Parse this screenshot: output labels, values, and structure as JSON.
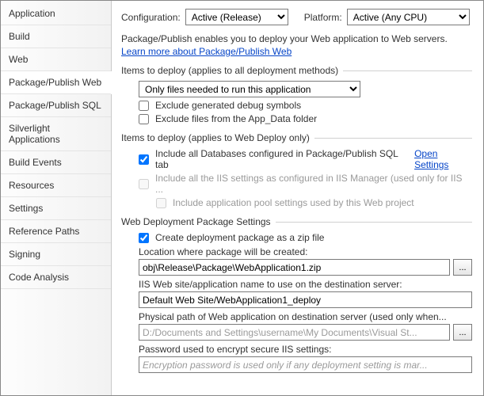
{
  "sidebar": {
    "items": [
      "Application",
      "Build",
      "Web",
      "Package/Publish Web",
      "Package/Publish SQL",
      "Silverlight Applications",
      "Build Events",
      "Resources",
      "Settings",
      "Reference Paths",
      "Signing",
      "Code Analysis"
    ],
    "active_index": 3
  },
  "top": {
    "config_label": "Configuration:",
    "config_value": "Active (Release)",
    "platform_label": "Platform:",
    "platform_value": "Active (Any CPU)"
  },
  "intro": {
    "line1": "Package/Publish enables you to deploy your Web application to Web servers.",
    "link": "Learn more about Package/Publish Web"
  },
  "section_all": {
    "header": "Items to deploy (applies to all deployment methods)",
    "select_value": "Only files needed to run this application",
    "cb_exclude_debug": "Exclude generated debug symbols",
    "cb_exclude_appdata": "Exclude files from the App_Data folder"
  },
  "section_webdeploy": {
    "header": "Items to deploy (applies to Web Deploy only)",
    "cb_include_db": "Include all Databases configured in Package/Publish SQL tab",
    "open_settings": "Open Settings",
    "cb_include_iis": "Include all the IIS settings as configured in IIS Manager (used only for IIS ...",
    "cb_include_apppool": "Include application pool settings used by this Web project"
  },
  "section_pkg": {
    "header": "Web Deployment Package Settings",
    "cb_zip": "Create deployment package as a zip file",
    "loc_caption": "Location where package will be created:",
    "loc_value": "obj\\Release\\Package\\WebApplication1.zip",
    "browse": "...",
    "iis_caption": "IIS Web site/application name to use on the destination server:",
    "iis_value": "Default Web Site/WebApplication1_deploy",
    "phys_caption": "Physical path of Web application on destination server (used only when...",
    "phys_value": "D:/Documents and Settings\\username\\My Documents\\Visual St...",
    "pw_caption": "Password used to encrypt secure IIS settings:",
    "pw_placeholder": "Encryption password is used only if any deployment setting is mar..."
  }
}
